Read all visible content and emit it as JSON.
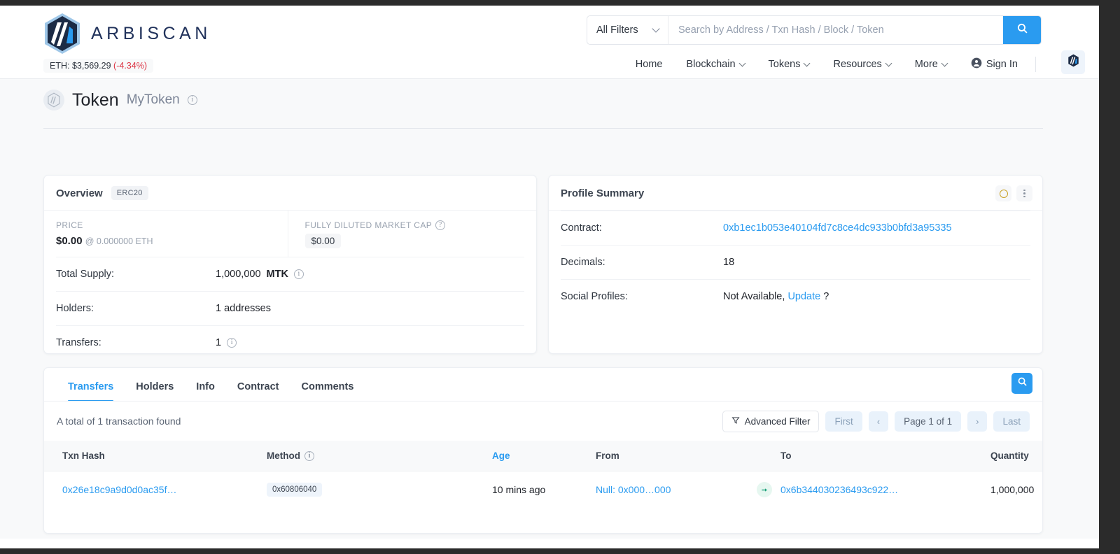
{
  "brand": {
    "name": "ARBISCAN",
    "logo_icon": "arbiscan-logo-icon",
    "accent": "#2a9bf0",
    "eth_label": "ETH: $3,569.29",
    "eth_change": "(-4.34%)",
    "eth_change_color": "#dc3545"
  },
  "search": {
    "filter_label": "All Filters",
    "placeholder": "Search by Address / Txn Hash / Block / Token",
    "value": "",
    "submit_icon": "search-icon"
  },
  "nav": {
    "items": [
      {
        "label": "Home",
        "caret": false
      },
      {
        "label": "Blockchain",
        "caret": true
      },
      {
        "label": "Tokens",
        "caret": true
      },
      {
        "label": "Resources",
        "caret": true
      },
      {
        "label": "More",
        "caret": true
      }
    ],
    "sign_in": "Sign In",
    "sign_in_icon": "user-circle-icon",
    "avatar_icon": "arbiscan-mark-icon"
  },
  "page": {
    "title": "Token",
    "subtitle": "MyToken",
    "info_icon": "info-icon",
    "token_icon": "token-placeholder-icon"
  },
  "overview": {
    "title": "Overview",
    "tag": "ERC20",
    "price_label": "PRICE",
    "price_value": "$0.00",
    "price_eth": "@ 0.000000 ETH",
    "mcap_label": "FULLY DILUTED MARKET CAP",
    "mcap_value": "$0.00",
    "rows": [
      {
        "key": "Total Supply:",
        "value": "1,000,000",
        "unit": "MTK",
        "info": true
      },
      {
        "key": "Holders:",
        "value": "1 addresses",
        "unit": "",
        "info": false
      },
      {
        "key": "Transfers:",
        "value": "1",
        "unit": "",
        "info": true
      }
    ]
  },
  "profile": {
    "title": "Profile Summary",
    "gold_icon": "gold-ring-icon",
    "menu_icon": "more-vertical-icon",
    "rows": [
      {
        "key": "Contract:",
        "value": "0xb1ec1b053e40104fd7c8ce4dc933b0bfd3a95335",
        "link": true
      },
      {
        "key": "Decimals:",
        "value": "18",
        "link": false
      },
      {
        "key": "Social Profiles:",
        "value": "Not Available,",
        "link_text": "Update",
        "suffix": "?"
      }
    ]
  },
  "table_card": {
    "tabs": [
      {
        "label": "Transfers",
        "active": true
      },
      {
        "label": "Holders",
        "active": false
      },
      {
        "label": "Info",
        "active": false
      },
      {
        "label": "Contract",
        "active": false
      },
      {
        "label": "Comments",
        "active": false
      }
    ],
    "search_icon": "search-icon",
    "summary": "A total of 1 transaction found",
    "advanced_filter": "Advanced Filter",
    "filter_icon": "funnel-icon",
    "pagination": {
      "first": "First",
      "prev": "‹",
      "page": "Page 1 of 1",
      "next": "›",
      "last": "Last"
    },
    "columns": [
      "Txn Hash",
      "Method",
      "Age",
      "From",
      "",
      "To",
      "Quantity"
    ],
    "method_info_icon": "info-icon",
    "age_sortable": true,
    "rows": [
      {
        "txn_hash": "0x26e18c9a9d0d0ac35f…",
        "method": "0x60806040",
        "age": "10 mins ago",
        "from": "Null: 0x000…000",
        "direction_icon": "arrow-right-icon",
        "to": "0x6b344030236493c922…",
        "quantity": "1,000,000"
      }
    ]
  }
}
